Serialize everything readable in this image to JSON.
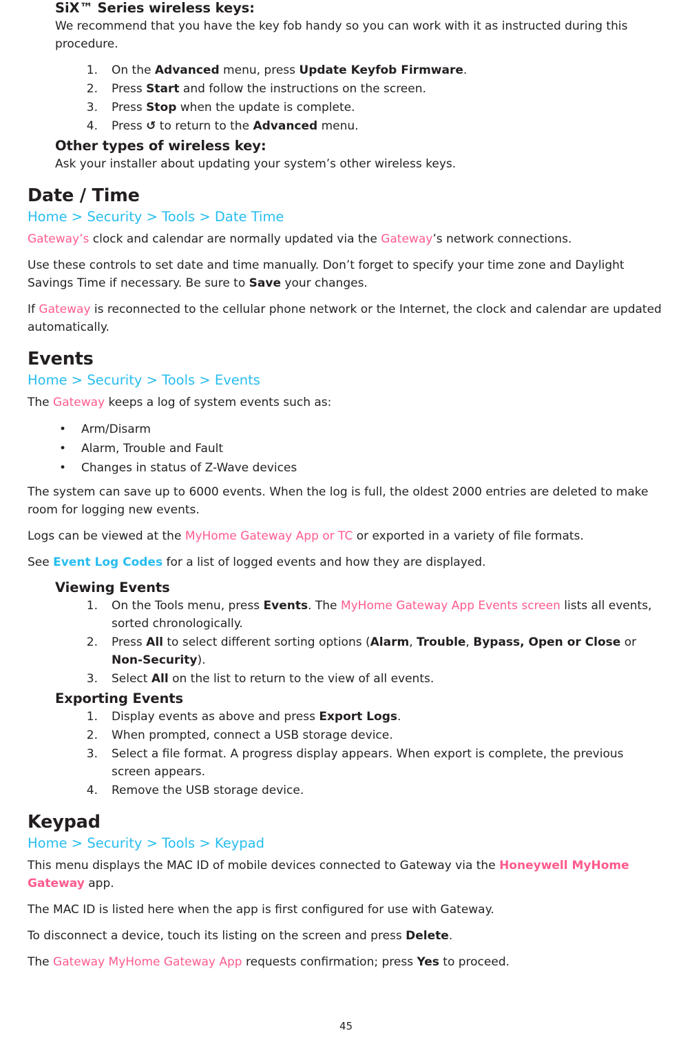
{
  "page": {
    "number": "45"
  },
  "wireless_keys": {
    "six_heading": "SiX™ Series wireless keys:",
    "intro": "We recommend that you have the key fob handy so you can work with it as instructed during this procedure.",
    "steps": [
      {
        "num": "1.",
        "pre": "On the ",
        "bold1": "Advanced",
        "mid": " menu, press ",
        "bold2": "Update Keyfob Firmware",
        "post": "."
      },
      {
        "num": "2.",
        "pre": "Press ",
        "bold1": "Start",
        "mid": " and follow the instructions on the screen.",
        "bold2": "",
        "post": ""
      },
      {
        "num": "3.",
        "pre": "Press ",
        "bold1": "Stop",
        "mid": " when the update is complete.",
        "bold2": "",
        "post": ""
      },
      {
        "num": "4.",
        "pre": "Press ",
        "bold1": "↺",
        "mid": "  to return to the ",
        "bold2": "Advanced",
        "post": " menu."
      }
    ],
    "other_heading": "Other types of wireless key:",
    "other_text": "Ask your installer about updating your system’s other wireless keys."
  },
  "date_time": {
    "title": "Date / Time",
    "breadcrumb": "Home > Security > Tools > Date Time",
    "p1_a": "Gateway’s",
    "p1_b": " clock and calendar are normally updated via the ",
    "p1_c": "Gateway",
    "p1_d": "’s network connections.",
    "p2_a": "Use these controls to set date and time manually. Don’t forget to specify your time zone and Daylight Savings Time if necessary. Be sure to ",
    "p2_bold": "Save",
    "p2_b": " your changes.",
    "p3_a": "If ",
    "p3_link": "Gateway",
    "p3_b": " is reconnected to the cellular phone network or the Internet, the clock and calendar are updated automatically."
  },
  "events": {
    "title": "Events",
    "breadcrumb": "Home > Security > Tools > Events",
    "intro_a": "The ",
    "intro_link": "Gateway",
    "intro_b": " keeps a log of system events such as:",
    "bullets": [
      "Arm/Disarm",
      "Alarm, Trouble and Fault",
      "Changes in status of Z-Wave devices"
    ],
    "p_capacity": "The system can save up to 6000 events. When the log is full, the oldest 2000 entries are deleted to make room for logging new events.",
    "p_logs_a": "Logs can be viewed at the ",
    "p_logs_link": "MyHome Gateway App or TC",
    "p_logs_b": " or exported in a variety of file formats.",
    "p_see_a": "See ",
    "p_see_link": "Event Log Codes",
    "p_see_b": " for a list of logged events and how they are displayed.",
    "viewing": {
      "heading": "Viewing Events",
      "step1": {
        "num": "1.",
        "a": "On the Tools menu, press ",
        "bold": "Events",
        "b": ". The ",
        "link": "MyHome Gateway App Events screen",
        "c": " lists all events, sorted chronologically."
      },
      "step2": {
        "num": "2.",
        "a": "Press ",
        "bold1": "All",
        "b": " to select different sorting options (",
        "bold2": "Alarm",
        "c": ", ",
        "bold3": "Trouble",
        "d": ", ",
        "bold4": "Bypass, Open or Close",
        "e": " or ",
        "bold5": "Non-Security",
        "f": ")."
      },
      "step3": {
        "num": "3.",
        "a": "Select ",
        "bold": "All",
        "b": " on the list to return to the view of all events."
      }
    },
    "exporting": {
      "heading": "Exporting Events",
      "steps": [
        {
          "num": "1.",
          "a": "Display events as above and press ",
          "bold": "Export Logs",
          "b": "."
        },
        {
          "num": "2.",
          "a": "When prompted, connect a USB storage device.",
          "bold": "",
          "b": ""
        },
        {
          "num": "3.",
          "a": "Select a file format. A progress display appears. When export is complete, the previous screen appears.",
          "bold": "",
          "b": ""
        },
        {
          "num": "4.",
          "a": "Remove the USB storage device.",
          "bold": "",
          "b": ""
        }
      ]
    }
  },
  "keypad": {
    "title": "Keypad",
    "breadcrumb": "Home > Security > Tools > Keypad",
    "p1_a": "This menu displays the MAC ID of mobile devices connected to Gateway via the ",
    "p1_bold": "Honeywell MyHome Gateway",
    "p1_b": " app.",
    "p2": "The MAC ID is listed here when the app is first configured for use with Gateway.",
    "p3_a": "To disconnect a device, touch its listing on the screen and press ",
    "p3_bold": "Delete",
    "p3_b": ".",
    "p4_a": "The ",
    "p4_link": "Gateway MyHome Gateway App",
    "p4_b": " requests confirmation; press ",
    "p4_bold": "Yes",
    "p4_c": " to proceed."
  }
}
